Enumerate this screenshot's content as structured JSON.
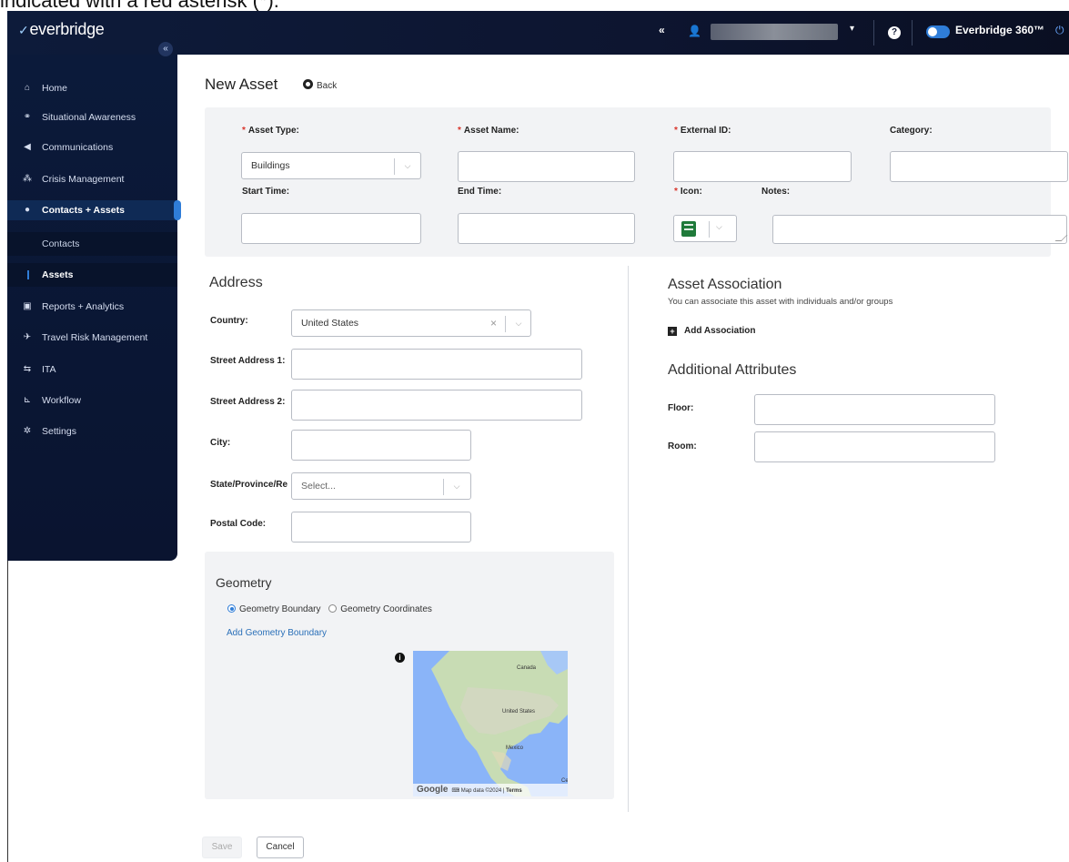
{
  "caption": "indicated with a red asterisk (*).",
  "header": {
    "brand": "everbridge",
    "collapse_label": "«",
    "user_caret": "▾",
    "help_label": "?",
    "product_name": "Everbridge 360™",
    "toggle_on": true
  },
  "sidebar": {
    "collapse_label": "«",
    "items": [
      {
        "label": "Home",
        "icon": "home-icon"
      },
      {
        "label": "Situational Awareness",
        "icon": "awareness-icon"
      },
      {
        "label": "Communications",
        "icon": "megaphone-icon"
      },
      {
        "label": "Crisis Management",
        "icon": "crisis-icon"
      },
      {
        "label": "Contacts + Assets",
        "icon": "location-pin-icon",
        "active": true
      },
      {
        "label": "Reports + Analytics",
        "icon": "reports-icon"
      },
      {
        "label": "Travel Risk Management",
        "icon": "plane-icon"
      },
      {
        "label": "ITA",
        "icon": "ita-icon"
      },
      {
        "label": "Workflow",
        "icon": "workflow-icon"
      },
      {
        "label": "Settings",
        "icon": "gear-icon"
      }
    ],
    "subitems": [
      {
        "label": "Contacts"
      },
      {
        "label": "Assets",
        "active": true
      }
    ]
  },
  "page": {
    "title": "New Asset",
    "back_label": "Back"
  },
  "form": {
    "asset_type_label": "Asset Type:",
    "asset_type_value": "Buildings",
    "asset_name_label": "Asset Name:",
    "external_id_label": "External ID:",
    "category_label": "Category:",
    "start_time_label": "Start Time:",
    "end_time_label": "End Time:",
    "icon_label": "Icon:",
    "notes_label": "Notes:",
    "required_mark": "*"
  },
  "address": {
    "title": "Address",
    "country_label": "Country:",
    "country_value": "United States",
    "street1_label": "Street Address 1:",
    "street2_label": "Street Address 2:",
    "city_label": "City:",
    "state_label": "State/Province/Re",
    "state_placeholder": "Select...",
    "postal_label": "Postal Code:"
  },
  "association": {
    "title": "Asset Association",
    "subtitle": "You can associate this asset with individuals and/or groups",
    "add_label": "Add Association"
  },
  "attributes": {
    "title": "Additional Attributes",
    "floor_label": "Floor:",
    "room_label": "Room:"
  },
  "geometry": {
    "title": "Geometry",
    "option_boundary": "Geometry Boundary",
    "option_coordinates": "Geometry Coordinates",
    "selected": "Geometry Boundary",
    "add_link": "Add Geometry Boundary",
    "map_labels": {
      "canada": "Canada",
      "us": "United States",
      "mexico": "Mexico",
      "edge": "Ce"
    },
    "map_footer": {
      "google": "Google",
      "data": "Map data ©2024",
      "terms": "Terms"
    }
  },
  "buttons": {
    "save": "Save",
    "cancel": "Cancel"
  },
  "colors": {
    "nav_bg": "#0b1a3a",
    "accent": "#2f7dd8",
    "required": "#d9342b",
    "link": "#2a6fb8"
  }
}
